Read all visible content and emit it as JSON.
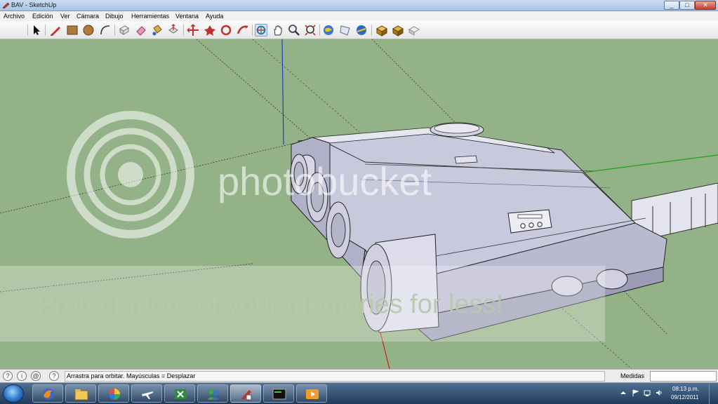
{
  "window": {
    "title": "BAV - SketchUp"
  },
  "window_controls": {
    "minimize": "_",
    "maximize": "□",
    "close": "✕"
  },
  "menu": [
    "Archivo",
    "Edición",
    "Ver",
    "Cámara",
    "Dibujo",
    "Herramientas",
    "Ventana",
    "Ayuda"
  ],
  "toolbar": {
    "icons": [
      "select-icon",
      "pencil-line-icon",
      "rectangle-icon",
      "circle-icon",
      "arc-icon",
      "eraser-make-component-icon",
      "eraser-icon",
      "paint-bucket-icon",
      "push-pull-icon",
      "move-icon",
      "rotate-icon",
      "offset-icon",
      "orbit-icon",
      "pan-icon",
      "zoom-icon",
      "zoom-extents-icon",
      "get-models-icon",
      "share-model-icon",
      "place-model-icon",
      "get-component-icon",
      "share-component-icon",
      "extension-icon"
    ],
    "active": "orbit-icon"
  },
  "status": {
    "message": "Arrastra para orbitar.  Mayúsculas = Desplazar",
    "measure_label": "Medidas",
    "measure_value": ""
  },
  "watermark": {
    "brand": "photobucket",
    "message": "Protect more of your memories for less!"
  },
  "taskbar": {
    "apps": [
      "start-button",
      "firefox-icon",
      "file-explorer-icon",
      "picasa-icon",
      "airplane-icon",
      "excel-icon",
      "messenger-icon",
      "sketchup-icon",
      "terminal-icon",
      "media-player-icon"
    ],
    "time": "08:13 p.m.",
    "date": "09/12/2011"
  },
  "colors": {
    "ground": "#93b287",
    "model_face": "#c9c9dd",
    "axis_red": "#d02020",
    "axis_green": "#20a020",
    "axis_blue": "#2040c0"
  }
}
